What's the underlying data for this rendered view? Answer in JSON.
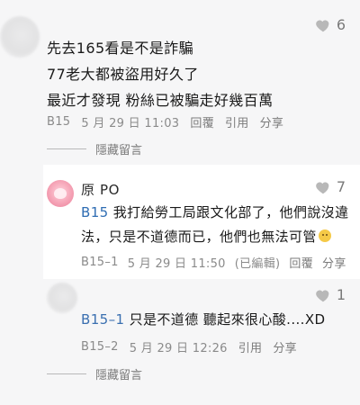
{
  "comment1": {
    "likes": "6",
    "lines": [
      "先去165看是不是詐騙",
      "77老大都被盜用好久了",
      "最近才發現 粉絲已被騙走好幾百萬"
    ],
    "meta": {
      "id": "B15",
      "datetime": "5 月 29 日 11:03",
      "reply": "回覆",
      "quote": "引用",
      "share": "分享"
    },
    "hide": "隱藏留言"
  },
  "reply1": {
    "author": "原 PO",
    "likes": "7",
    "mention": "B15",
    "line1": "我打給勞工局跟文化部了，他們說沒違",
    "line2": "法，只是不道德而已，他們也無法可管",
    "meta": {
      "id": "B15–1",
      "datetime": "5 月 29 日 11:50",
      "edited": "(已編輯)",
      "reply": "回覆",
      "share": "分享"
    },
    "avatar_color": "#f5a3b6"
  },
  "reply2": {
    "likes": "1",
    "mention": "B15–1",
    "text": "只是不道德 聽起來很心酸....XD",
    "meta": {
      "id": "B15–2",
      "datetime": "5 月 29 日 12:26",
      "quote": "引用",
      "share": "分享"
    },
    "hide": "隱藏留言"
  },
  "colors": {
    "link_blue": "#2f6db3",
    "meta_gray": "#8a8a8a",
    "background": "#f6f6f7"
  }
}
